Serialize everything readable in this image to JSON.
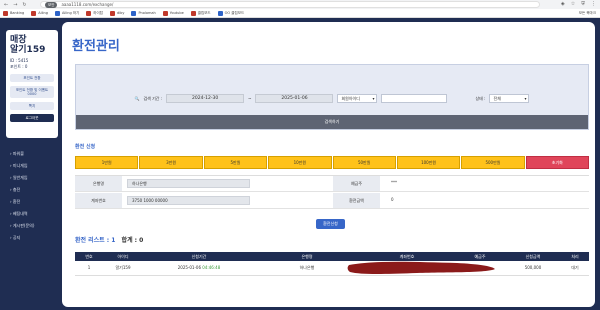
{
  "browser": {
    "url_secure_label": "보안",
    "url": "aaaa1118.com/exchange/",
    "bookmarks": [
      "Banking",
      "Ailing",
      "Ailing 하기",
      "하이탑",
      "diby",
      "Pnolomah",
      "Youtube",
      "클립보드",
      "OO 클립보드"
    ],
    "bookmarks_right": "모든 북마크"
  },
  "sidebar": {
    "user_name_1": "매장",
    "user_name_2": "알기159",
    "level": "ID : 5415",
    "points": "포인트 : 0",
    "btn_point_convert": "포인트 전환",
    "btn_coupon": "포인트 전환 및 이벤트 0000",
    "btn_notice": "쪽지",
    "btn_logout": "로그아웃",
    "menu": [
      "파워볼",
      "미니게임",
      "일반게임",
      "충전",
      "환전",
      "베팅내역",
      "게시판(문의)",
      "공지"
    ]
  },
  "page": {
    "title": "환전관리"
  },
  "search": {
    "period_label": "검색 기간 :",
    "date_from": "2024-12-30",
    "tilde": "~",
    "date_to": "2025-01-06",
    "field_select": "회원아이디",
    "status_label": "상태 :",
    "status_select": "전체",
    "search_button": "검색하기"
  },
  "exchange_form": {
    "section_title": "환전 신청",
    "amount_buttons": [
      "1만원",
      "3만원",
      "5만원",
      "10만원",
      "50만원",
      "100만원",
      "500만원"
    ],
    "reset_button": "초기화",
    "bank_label": "은행명",
    "bank_value": "하나은행",
    "holder_label": "예금주",
    "holder_value": "***",
    "account_label": "계좌번호",
    "account_value": "3750 1000 00000",
    "amount_label": "환전금액",
    "amount_value": "0",
    "submit_button": "환전신청"
  },
  "list": {
    "title": "환전 리스트 : 1",
    "total": "합계 : 0"
  },
  "table": {
    "columns": [
      "번호",
      "아이디",
      "신청기간",
      "은행명",
      "계좌번호",
      "예금주",
      "신청금액",
      "처리"
    ],
    "rows": [
      {
        "no": "1",
        "user_id": "알기159",
        "date": "2025-01-06 ",
        "time": "04:46:48",
        "bank": "하나은행",
        "account": "",
        "holder": "",
        "amount": "500,000",
        "status": "대기"
      }
    ]
  },
  "colors": {
    "navy": "#1f2d52",
    "blue": "#3766c8",
    "amount_btn": "#ffc21a",
    "reset_btn": "#e0455a",
    "redaction": "#8b1a1a"
  }
}
